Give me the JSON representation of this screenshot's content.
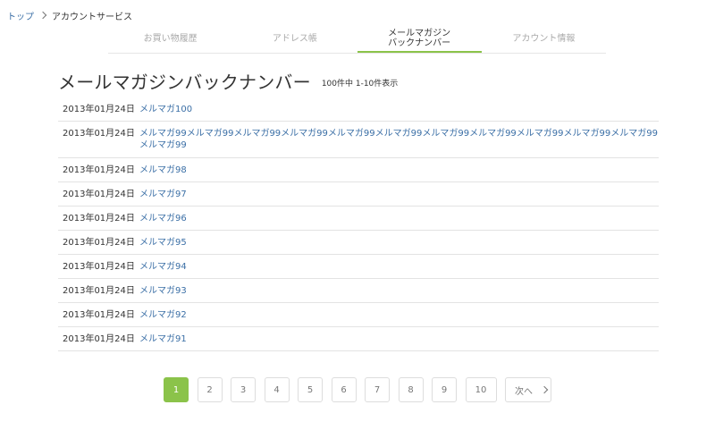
{
  "breadcrumb": {
    "top_label": "トップ",
    "current_label": "アカウントサービス"
  },
  "tabs": [
    {
      "label": "お買い物履歴",
      "active": false
    },
    {
      "label": "アドレス帳",
      "active": false
    },
    {
      "label": "メールマガジン\nバックナンバー",
      "active": true
    },
    {
      "label": "アカウント情報",
      "active": false
    }
  ],
  "page": {
    "title": "メールマガジンバックナンバー",
    "count_text": "100件中 1-10件表示"
  },
  "items": [
    {
      "date": "2013年01月24日",
      "title": "メルマガ100"
    },
    {
      "date": "2013年01月24日",
      "title": "メルマガ99メルマガ99メルマガ99メルマガ99メルマガ99メルマガ99メルマガ99メルマガ99メルマガ99メルマガ99メルマガ99メルマガ99"
    },
    {
      "date": "2013年01月24日",
      "title": "メルマガ98"
    },
    {
      "date": "2013年01月24日",
      "title": "メルマガ97"
    },
    {
      "date": "2013年01月24日",
      "title": "メルマガ96"
    },
    {
      "date": "2013年01月24日",
      "title": "メルマガ95"
    },
    {
      "date": "2013年01月24日",
      "title": "メルマガ94"
    },
    {
      "date": "2013年01月24日",
      "title": "メルマガ93"
    },
    {
      "date": "2013年01月24日",
      "title": "メルマガ92"
    },
    {
      "date": "2013年01月24日",
      "title": "メルマガ91"
    }
  ],
  "pagination": {
    "pages": [
      "1",
      "2",
      "3",
      "4",
      "5",
      "6",
      "7",
      "8",
      "9",
      "10"
    ],
    "current": "1",
    "next_label": "次へ"
  },
  "colors": {
    "accent": "#8bc34a",
    "link": "#3b6fa6"
  },
  "icons": {
    "breadcrumb_separator": "chevron-right-icon",
    "next": "chevron-right-icon"
  }
}
